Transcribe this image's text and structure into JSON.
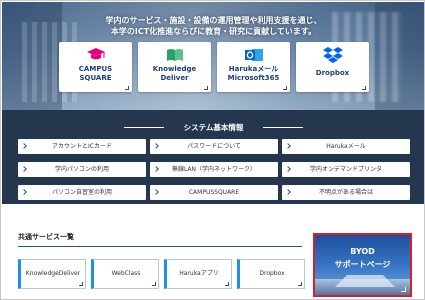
{
  "hero": {
    "line1": "学内のサービス・施設・設備の運用管理や利用支援を通じ、",
    "line2": "本学のICT化推進ならびに教育・研究に貢献しています。"
  },
  "tiles": [
    {
      "label1": "CAMPUS",
      "label2": "SQUARE",
      "icon": "graduation-cap-icon",
      "color": "#e4007f"
    },
    {
      "label1": "Knowledge",
      "label2": "Deliver",
      "icon": "book-icon",
      "color": "#2aa36b"
    },
    {
      "label1": "Harukaメール",
      "label2": "Microsoft365",
      "icon": "outlook-icon",
      "color": "#0a64c8"
    },
    {
      "label1": "Dropbox",
      "label2": "",
      "icon": "dropbox-icon",
      "color": "#0061fe"
    }
  ],
  "system": {
    "title": "システム基本情報",
    "items": [
      "アカウントとICカード",
      "パスワードについて",
      "Harukaメール",
      "学内パソコンの利用",
      "無線LAN（学内ネットワーク）",
      "学内オンデマンドプリンタ",
      "パソコン自習室の利用",
      "CAMPUSSQUARE",
      "不明点がある場合は"
    ]
  },
  "common": {
    "title": "共通サービス一覧",
    "services": [
      "KnowledgeDeliver",
      "WebClass",
      "Harukaアプリ",
      "Dropbox"
    ]
  },
  "byod": {
    "line1": "BYOD",
    "line2": "サポートページ"
  }
}
